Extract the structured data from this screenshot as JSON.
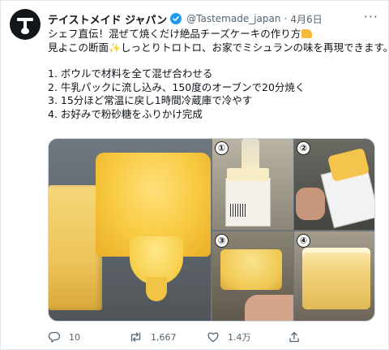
{
  "tweet": {
    "display_name": "テイストメイド ジャパン",
    "handle": "@Tastemade_japan",
    "separator": "·",
    "date": "4月6日",
    "more_label": "···",
    "lines": [
      "シェフ直伝！混ぜて焼くだけ絶品チーズケーキの作り方",
      "見よこの断面",
      "しっとりトロトロ、お家でミシュランの味を再現できます。",
      "1. ボウルで材料を全て混ぜ合わせる",
      "2. 牛乳パックに流し込み、150度のオーブンで20分焼く",
      "3. 15分ほど常温に戻し1時間冷蔵庫で冷やす",
      "4. お好みで粉砂糖をふりかけ完成"
    ],
    "emoji": {
      "cheese": "cheese-wedge",
      "sparkles": "✨"
    }
  },
  "media": {
    "steps": [
      "①",
      "②",
      "③",
      "④"
    ]
  },
  "actions": {
    "reply_count": "10",
    "retweet_count": "1,667",
    "like_count": "1.4万",
    "share_label": ""
  },
  "colors": {
    "verified_blue": "#1d9bf0",
    "text_secondary": "#536471",
    "text_primary": "#0f1419"
  }
}
